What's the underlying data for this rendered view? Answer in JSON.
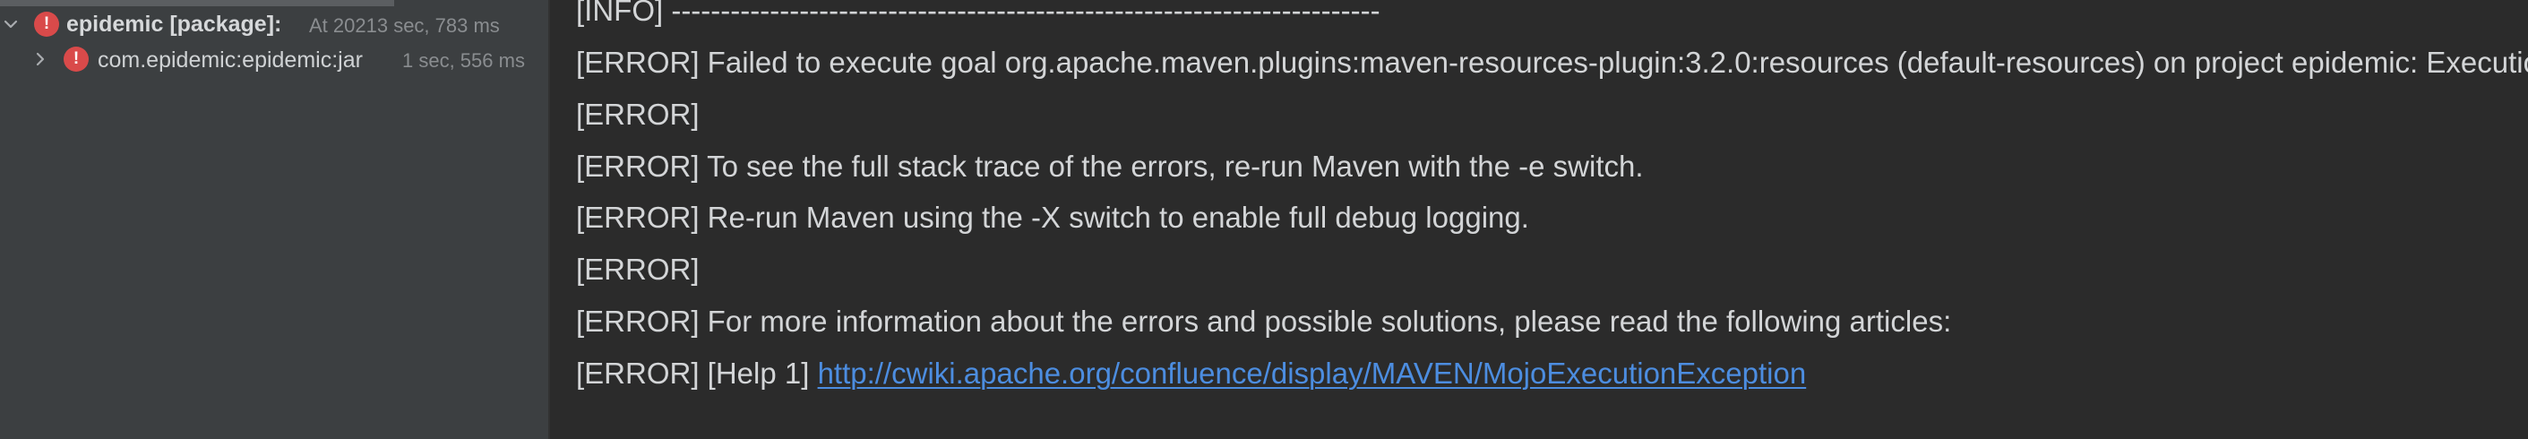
{
  "tree": {
    "root": {
      "name": "epidemic [package]:",
      "time": "At 20213 sec, 783 ms",
      "badge": "!",
      "expanded": true
    },
    "child": {
      "name": "com.epidemic:epidemic:jar",
      "time": "1 sec, 556 ms",
      "badge": "!",
      "expanded": false
    }
  },
  "console": {
    "lines": [
      {
        "text": "[INFO] ------------------------------------------------------------------------"
      },
      {
        "text": "[ERROR] Failed to execute goal org.apache.maven.plugins:maven-resources-plugin:3.2.0:resources (default-resources) on project epidemic: Execution default-resources of goal"
      },
      {
        "text": "[ERROR]"
      },
      {
        "text": "[ERROR] To see the full stack trace of the errors, re-run Maven with the -e switch."
      },
      {
        "text": "[ERROR] Re-run Maven using the -X switch to enable full debug logging."
      },
      {
        "text": "[ERROR]"
      },
      {
        "text": "[ERROR] For more information about the errors and possible solutions, please read the following articles:"
      },
      {
        "prefix": "[ERROR] [Help 1] ",
        "link": "http://cwiki.apache.org/confluence/display/MAVEN/MojoExecutionException"
      }
    ]
  },
  "colors": {
    "error_badge": "#d94a4a",
    "link": "#4c8de0",
    "console_bg": "#2b2b2b",
    "tree_bg": "#3c3f41"
  },
  "icons": {
    "expanded": "chevron-down-icon",
    "collapsed": "chevron-right-icon",
    "status": "error-icon"
  }
}
